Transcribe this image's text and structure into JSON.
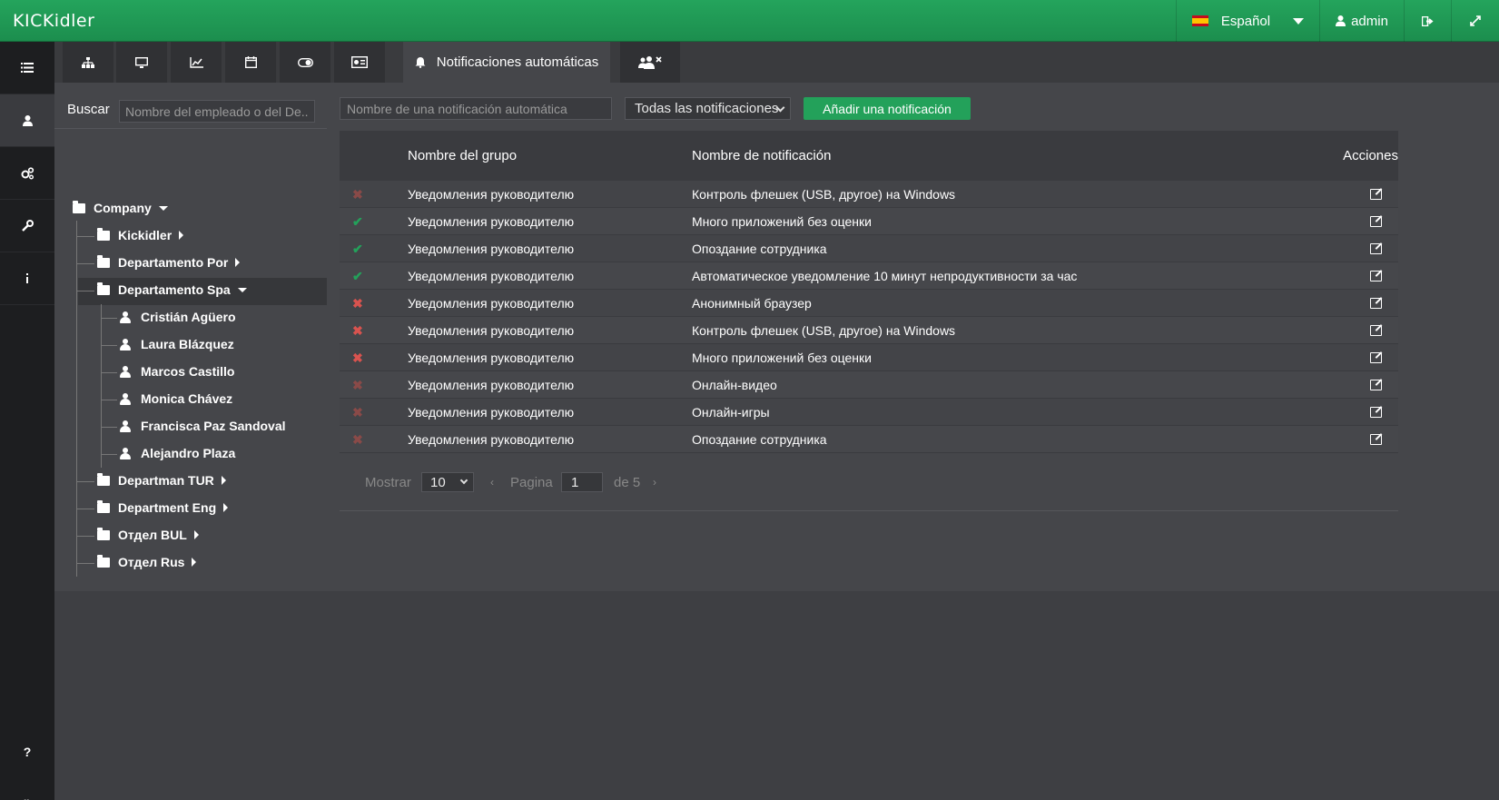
{
  "app": {
    "logo": "KICKidler"
  },
  "topbar": {
    "language": "Español",
    "user": "admin",
    "icons": [
      "flag-es-icon",
      "user-icon",
      "logout-icon",
      "fullscreen-icon"
    ]
  },
  "sidebar": {
    "items": [
      {
        "icon": "list-icon",
        "active": false
      },
      {
        "icon": "user-icon",
        "active": true
      },
      {
        "icon": "gears-icon",
        "active": false
      },
      {
        "icon": "wrench-icon",
        "active": false
      },
      {
        "icon": "info-icon",
        "active": false
      }
    ],
    "help": "?",
    "expand": "»"
  },
  "tabs": {
    "icons": [
      "sitemap-icon",
      "desktop-icon",
      "line-chart-icon",
      "calendar-icon",
      "toggle-icon",
      "id-card-icon",
      "bell-icon",
      "users-remove-icon"
    ],
    "active_label": "Notificaciones automáticas"
  },
  "search": {
    "label": "Buscar",
    "placeholder": "Nombre del empleado o del De..."
  },
  "tree": {
    "root": "Company",
    "departments": [
      "Kickidler",
      "Departamento Por",
      "Departamento Spa",
      "Departman TUR",
      "Department Eng",
      "Отдел BUL",
      "Отдел Rus"
    ],
    "employees": [
      "Cristián Agüero",
      "Laura Blázquez",
      "Marcos Castillo",
      "Monica Chávez",
      "Francisca Paz Sandoval",
      "Alejandro Plaza"
    ]
  },
  "filters": {
    "search_placeholder": "Nombre de una notificación automática",
    "select_value": "Todas las notificaciones",
    "add_button": "Añadir una notificación"
  },
  "table": {
    "headers": {
      "group": "Nombre del grupo",
      "notification": "Nombre de notificación",
      "actions": "Acciones"
    },
    "rows": [
      {
        "status": "off-dim",
        "group": "Уведомления руководителю",
        "notification": "Контроль флешек (USB, другое) на Windows"
      },
      {
        "status": "on",
        "group": "Уведомления руководителю",
        "notification": "Много приложений без оценки"
      },
      {
        "status": "on",
        "group": "Уведомления руководителю",
        "notification": "Опоздание сотрудника"
      },
      {
        "status": "on",
        "group": "Уведомления руководителю",
        "notification": "Автоматическое уведомление 10 минут непродуктивности за час"
      },
      {
        "status": "off",
        "group": "Уведомления руководителю",
        "notification": "Анонимный браузер"
      },
      {
        "status": "off",
        "group": "Уведомления руководителю",
        "notification": "Контроль флешек (USB, другое) на Windows"
      },
      {
        "status": "off",
        "group": "Уведомления руководителю",
        "notification": "Много приложений без оценки"
      },
      {
        "status": "off-dim",
        "group": "Уведомления руководителю",
        "notification": "Онлайн-видео"
      },
      {
        "status": "off-dim",
        "group": "Уведомления руководителю",
        "notification": "Онлайн-игры"
      },
      {
        "status": "off-dim",
        "group": "Уведомления руководителю",
        "notification": "Опоздание сотрудника"
      }
    ]
  },
  "pager": {
    "show_label": "Mostrar",
    "show_value": "10",
    "prev": "‹",
    "page_label": "Pagina",
    "page_value": "1",
    "of_label": "de 5",
    "next": "›"
  },
  "colors": {
    "brand": "#23a15a",
    "status_on": "#23a15a",
    "status_off": "#d9534f"
  }
}
